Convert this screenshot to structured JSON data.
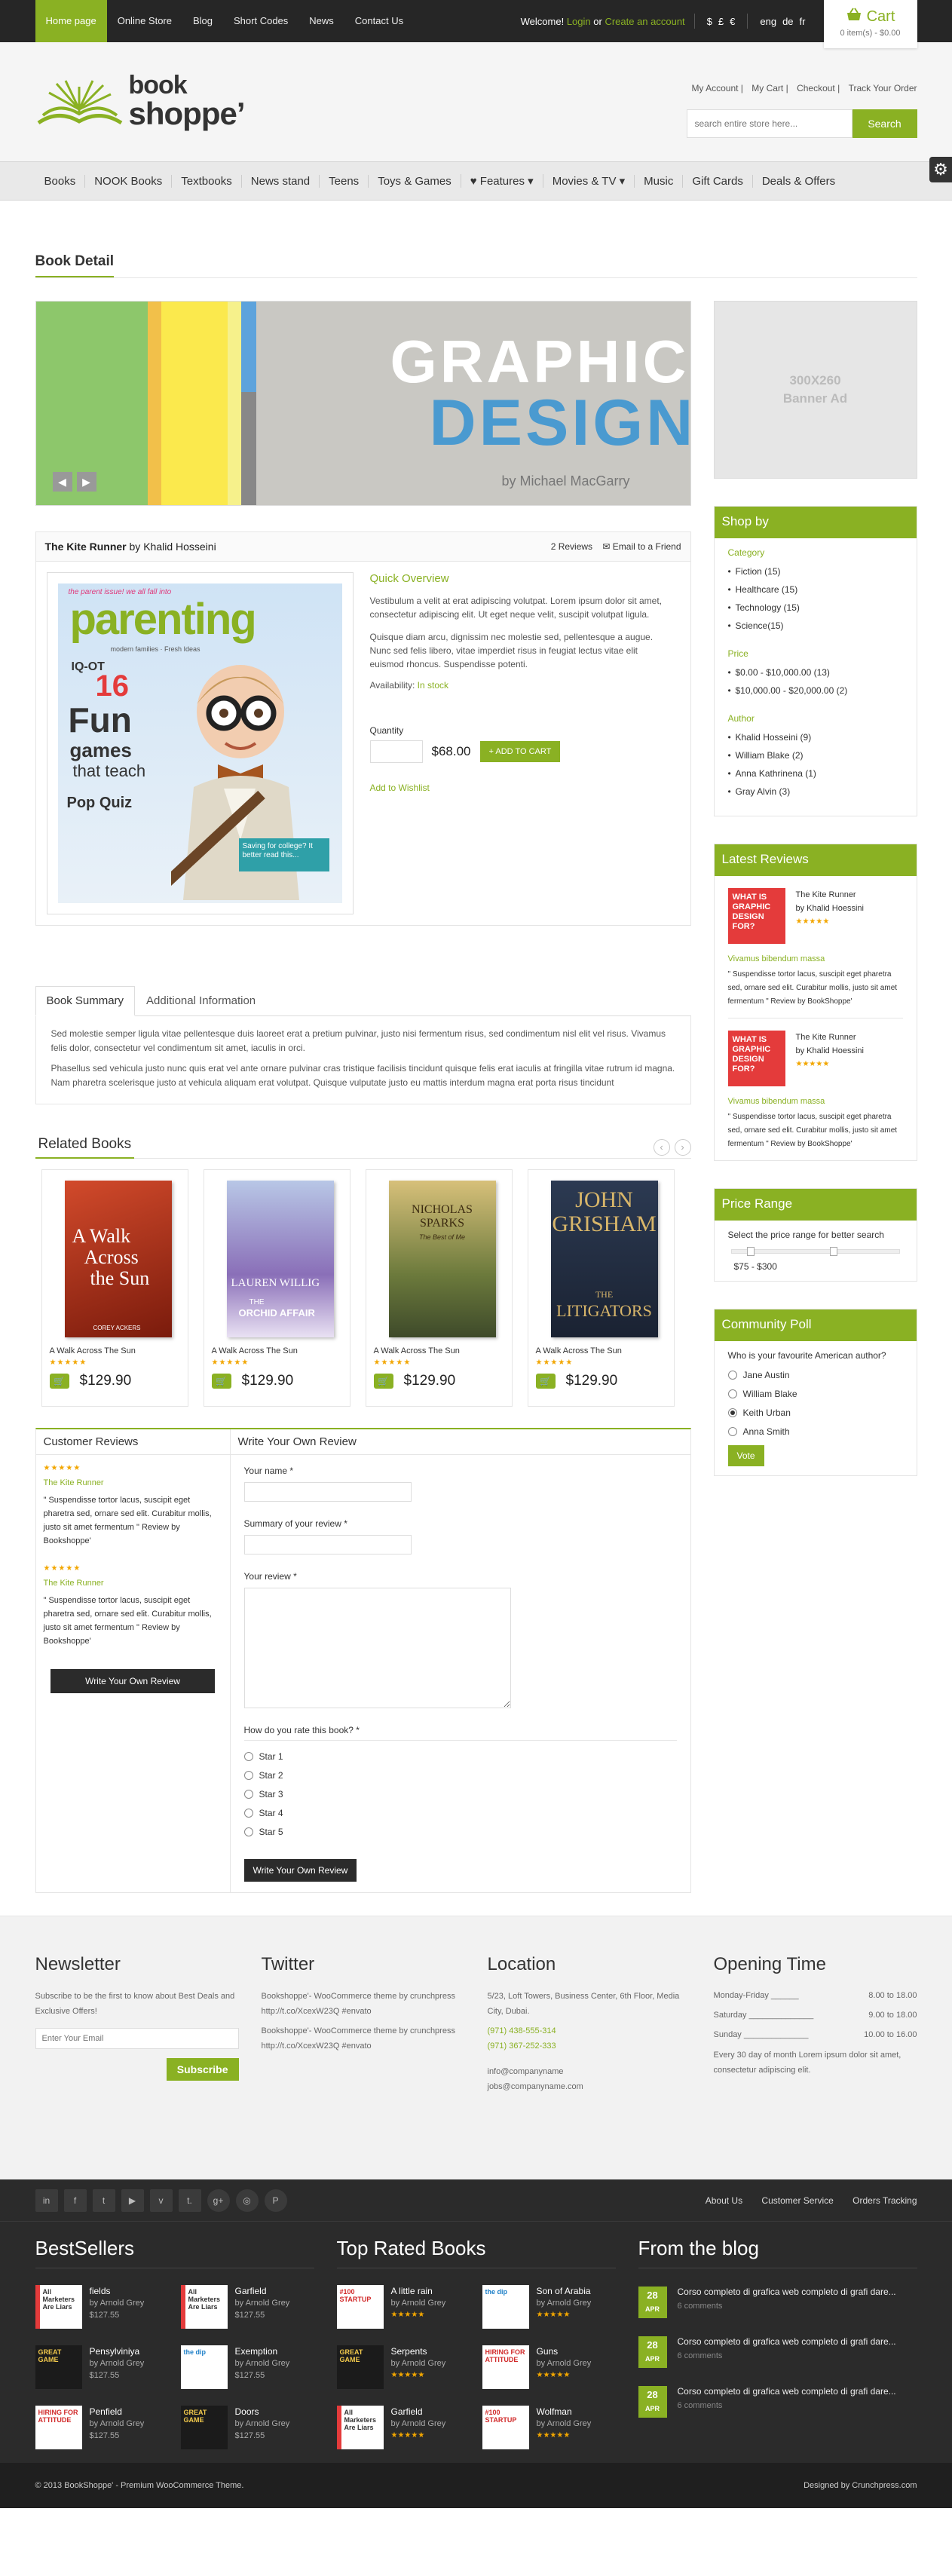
{
  "topbar": {
    "nav": [
      "Home page",
      "Online Store",
      "Blog",
      "Short Codes",
      "News",
      "Contact Us"
    ],
    "welcome": "Welcome!",
    "login": "Login",
    "or": "or",
    "create": "Create an account",
    "currencies": [
      "$",
      "£",
      "€"
    ],
    "languages": [
      "eng",
      "de",
      "fr"
    ]
  },
  "cart": {
    "label": "Cart",
    "summary": "0 item(s) - $0.00"
  },
  "header": {
    "logo_line1": "book",
    "logo_line2": "shoppe’",
    "account_links": [
      "My Account",
      "My Cart",
      "Checkout",
      "Track Your Order"
    ],
    "search_placeholder": "search entire store here...",
    "search_button": "Search"
  },
  "mainnav": [
    "Books",
    "NOOK Books",
    "Textbooks",
    "News stand",
    "Teens",
    "Toys & Games",
    "Features",
    "Movies & TV",
    "Music",
    "Gift Cards",
    "Deals & Offers"
  ],
  "page": {
    "title": "Book Detail"
  },
  "banner": {
    "line1": "GRAPHIC",
    "line2": "DESIGN",
    "author": "by Michael MacGarry"
  },
  "product": {
    "title": "The Kite Runner",
    "by": "by Khalid Hosseini",
    "reviews": "2 Reviews",
    "email": "Email to a Friend",
    "cover_title": "parenting",
    "cover_tag": "the parent issue! we all fall into",
    "cover_sub": "modern families · Fresh Ideas",
    "cover_iq": "IQ-OT",
    "cover_num": "16",
    "cover_fun": "Fun",
    "cover_games": "games",
    "cover_teach": "that teach",
    "cover_pop": "Pop Quiz",
    "cover_savings": "Saving for college? It better read this...",
    "quick_overview": "Quick Overview",
    "desc1": "Vestibulum a velit at erat adipiscing volutpat. Lorem ipsum dolor sit amet, consectetur adipiscing elit. Ut eget neque velit, suscipit volutpat ligula.",
    "desc2": "Quisque diam arcu, dignissim nec molestie sed, pellentesque a augue. Nunc sed felis libero, vitae imperdiet risus in feugiat lectus vitae elit euismod rhoncus. Suspendisse potenti.",
    "availability_label": "Availability:",
    "availability": "In stock",
    "qty_label": "Quantity",
    "price": "$68.00",
    "add_to_cart": "+ ADD TO CART",
    "wishlist": "Add to Wishlist"
  },
  "tabs": {
    "items": [
      "Book Summary",
      "Additional Information"
    ],
    "p1": "Sed molestie semper ligula vitae pellentesque duis laoreet erat a pretium pulvinar, justo nisi fermentum risus, sed condimentum nisl elit vel risus. Vivamus felis dolor, consectetur vel condimentum sit amet, iaculis in orci.",
    "p2": "Phasellus sed vehicula justo nunc quis erat vel ante ornare pulvinar cras tristique facilisis tincidunt quisque felis erat iaculis at fringilla vitae rutrum id magna. Nam pharetra scelerisque justo at vehicula aliquam erat volutpat. Quisque vulputate justo eu mattis interdum magna erat porta risus tincidunt"
  },
  "related": {
    "title": "Related Books",
    "books": [
      {
        "name": "A Walk Across The Sun",
        "price": "$129.90",
        "cover1": "A Walk",
        "cover2": "Across",
        "cover3": "the Sun",
        "cover4": "COREY ACKERS"
      },
      {
        "name": "A Walk Across The Sun",
        "price": "$129.90",
        "cover1": "LAUREN WILLIG",
        "cover2": "THE",
        "cover3": "ORCHID AFFAIR",
        "cover4": ""
      },
      {
        "name": "A Walk Across The Sun",
        "price": "$129.90",
        "cover1": "NICHOLAS SPARKS",
        "cover2": "The Best of Me",
        "cover3": "",
        "cover4": ""
      },
      {
        "name": "A Walk Across The Sun",
        "price": "$129.90",
        "cover1": "JOHN",
        "cover2": "GRISHAM",
        "cover3": "THE",
        "cover4": "LITIGATORS"
      }
    ]
  },
  "reviews": {
    "customer_title": "Customer Reviews",
    "items": [
      {
        "book": "The Kite Runner",
        "quote": "\" Suspendisse tortor lacus, suscipit eget pharetra sed, ornare sed elit. Curabitur mollis, justo sit amet fermentum \" Review by Bookshoppe'"
      },
      {
        "book": "The Kite Runner",
        "quote": "\" Suspendisse tortor lacus, suscipit eget pharetra sed, ornare sed elit. Curabitur mollis, justo sit amet fermentum \" Review by Bookshoppe'"
      }
    ],
    "write_button": "Write Your Own Review",
    "form_title": "Write Your Own Review",
    "name_label": "Your name *",
    "summary_label": "Summary of your review *",
    "review_label": "Your review *",
    "rate_label": "How do you rate this book? *",
    "stars": [
      "Star 1",
      "Star 2",
      "Star 3",
      "Star 4",
      "Star 5"
    ],
    "submit": "Write Your Own Review"
  },
  "sidebar": {
    "ad": [
      "300X260",
      "Banner Ad"
    ],
    "shopby": {
      "title": "Shop by",
      "category_label": "Category",
      "categories": [
        "Fiction (15)",
        "Healthcare (15)",
        "Technology (15)",
        "Science(15)"
      ],
      "price_label": "Price",
      "prices": [
        "$0.00 - $10,000.00 (13)",
        "$10,000.00 - $20,000.00 (2)"
      ],
      "author_label": "Author",
      "authors": [
        "Khalid Hosseini (9)",
        "William Blake (2)",
        "Anna Kathrinena (1)",
        "Gray Alvin (3)"
      ]
    },
    "latest": {
      "title": "Latest Reviews",
      "items": [
        {
          "img": "WHAT IS GRAPHIC DESIGN FOR?",
          "book": "The Kite Runner",
          "author": "by Khalid Hoessini",
          "caption": "Vivamus bibendum massa",
          "quote": "\" Suspendisse tortor lacus, suscipit eget pharetra sed, ornare sed elit. Curabitur mollis, justo sit amet fermentum \" Review by BookShoppe'"
        },
        {
          "img": "WHAT IS GRAPHIC DESIGN FOR?",
          "book": "The Kite Runner",
          "author": "by Khalid Hoessini",
          "caption": "Vivamus bibendum massa",
          "quote": "\" Suspendisse tortor lacus, suscipit eget pharetra sed, ornare sed elit. Curabitur mollis, justo sit amet fermentum \" Review by BookShoppe'"
        }
      ]
    },
    "price_range": {
      "title": "Price Range",
      "desc": "Select the price range for better search",
      "value": "$75 - $300"
    },
    "poll": {
      "title": "Community Poll",
      "question": "Who is your favourite American author?",
      "options": [
        "Jane Austin",
        "William Blake",
        "Keith Urban",
        "Anna Smith"
      ],
      "selected": 2,
      "vote": "Vote"
    }
  },
  "footer": {
    "newsletter": {
      "title": "Newsletter",
      "text": "Subscribe to be the first to know about Best Deals and Exclusive Offers!",
      "placeholder": "Enter Your Email",
      "button": "Subscribe"
    },
    "twitter": {
      "title": "Twitter",
      "tweets": [
        {
          "text": "Bookshoppe'- WooCommerce theme by crunchpress",
          "link": "http://t.co/XcexW23Q #envato"
        },
        {
          "text": "Bookshoppe'- WooCommerce theme by crunchpress",
          "link": "http://t.co/XcexW23Q #envato"
        }
      ]
    },
    "location": {
      "title": "Location",
      "address": "5/23, Loft Towers, Business Center, 6th Floor, Media City, Dubai.",
      "phone1": "(971) 438-555-314",
      "phone2": "(971) 367-252-333",
      "email1": "info@companyname",
      "email2": "jobs@companyname.com"
    },
    "opening": {
      "title": "Opening Time",
      "rows": [
        {
          "day": "Monday-Friday ______",
          "time": "8.00 to 18.00"
        },
        {
          "day": "Saturday ______________",
          "time": "9.00 to 18.00"
        },
        {
          "day": "Sunday ______________",
          "time": "10.00 to 16.00"
        }
      ],
      "note": "Every 30 day of month Lorem ipsum dolor sit amet, consectetur adipiscing elit."
    },
    "social": [
      "in",
      "f",
      "t",
      "▶",
      "v",
      "t.",
      "g+",
      "◎",
      "P"
    ],
    "links": [
      "About Us",
      "Customer Service",
      "Orders Tracking"
    ],
    "bestsellers": {
      "title": "BestSellers",
      "items": [
        {
          "name": "fields",
          "by": "by Arnold Grey",
          "price": "$127.55",
          "img": "All Marketers Are Liars"
        },
        {
          "name": "Garfield",
          "by": "by Arnold Grey",
          "price": "$127.55",
          "img": "All Marketers Are Liars"
        },
        {
          "name": "Pensylviniya",
          "by": "by Arnold Grey",
          "price": "$127.55",
          "img": "GREAT GAME"
        },
        {
          "name": "Exemption",
          "by": "by Arnold Grey",
          "price": "$127.55",
          "img": "the dip"
        },
        {
          "name": "Penfield",
          "by": "by Arnold Grey",
          "price": "$127.55",
          "img": "HIRING FOR ATTITUDE"
        },
        {
          "name": "Doors",
          "by": "by Arnold Grey",
          "price": "$127.55",
          "img": "GREAT GAME"
        }
      ]
    },
    "toprated": {
      "title": "Top Rated Books",
      "items": [
        {
          "name": "A little rain",
          "by": "by Arnold Grey",
          "img": "#100 STARTUP"
        },
        {
          "name": "Son of Arabia",
          "by": "by Arnold Grey",
          "img": "the dip"
        },
        {
          "name": "Serpents",
          "by": "by Arnold Grey",
          "img": "GREAT GAME"
        },
        {
          "name": "Guns",
          "by": "by Arnold Grey",
          "img": "HIRING FOR ATTITUDE"
        },
        {
          "name": "Garfield",
          "by": "by Arnold Grey",
          "img": "All Marketers Are Liars"
        },
        {
          "name": "Wolfman",
          "by": "by Arnold Grey",
          "img": "#100 STARTUP"
        }
      ]
    },
    "blog": {
      "title": "From the blog",
      "items": [
        {
          "day": "28",
          "month": "APR",
          "title": "Corso completo di grafica web completo di grafi dare...",
          "comments": "6 comments"
        },
        {
          "day": "28",
          "month": "APR",
          "title": "Corso completo di grafica web completo di grafi dare...",
          "comments": "6 comments"
        },
        {
          "day": "28",
          "month": "APR",
          "title": "Corso completo di grafica web completo di grafi dare...",
          "comments": "6 comments"
        }
      ]
    },
    "copyright": "© 2013 BookShoppe' - Premium WooCommerce Theme.",
    "designed": "Designed by Crunchpress.com"
  },
  "colors": {
    "accent": "#8ab123",
    "dark": "#2b2b2b",
    "star": "#f2a600"
  }
}
